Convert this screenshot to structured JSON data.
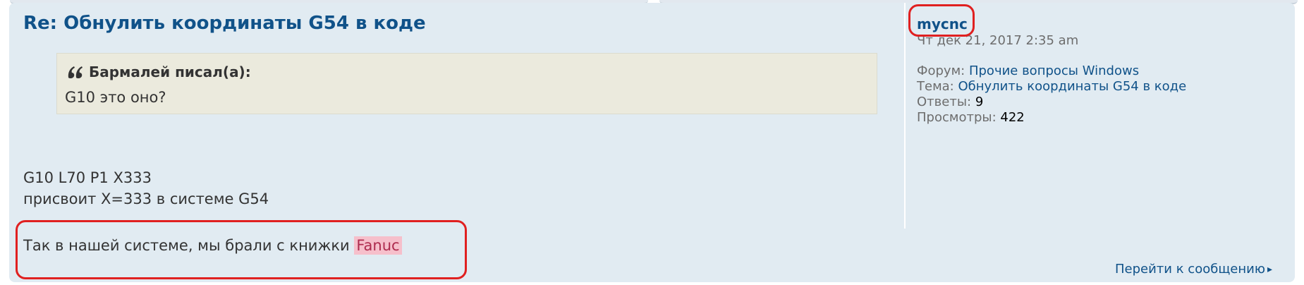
{
  "post": {
    "title": "Re: Обнулить координаты G54 в коде",
    "quote": {
      "cite": "Бармалей писал(а):",
      "text": "G10 это оно?"
    },
    "body_lines": [
      "G10 L70 P1 X333",
      "присвоит X=333 в системе G54"
    ],
    "last_line_prefix": "Так в нашей системе, мы брали с книжки ",
    "highlighted_word": "Fanuc"
  },
  "sidebar": {
    "author": "mycnc",
    "date": "Чт дек 21, 2017 2:35 am",
    "forum_label": "Форум:",
    "forum_value": "Прочие вопросы Windows",
    "topic_label": "Тема:",
    "topic_value": "Обнулить координаты G54 в коде",
    "replies_label": "Ответы:",
    "replies_value": "9",
    "views_label": "Просмотры:",
    "views_value": "422"
  },
  "footer": {
    "goto_label": "Перейти к сообщению"
  },
  "colors": {
    "card_bg": "#e1ebf2",
    "link": "#105289",
    "quote_bg": "#ebeadd",
    "highlight_bg": "#f6bfcb",
    "annotation": "#e02020"
  }
}
